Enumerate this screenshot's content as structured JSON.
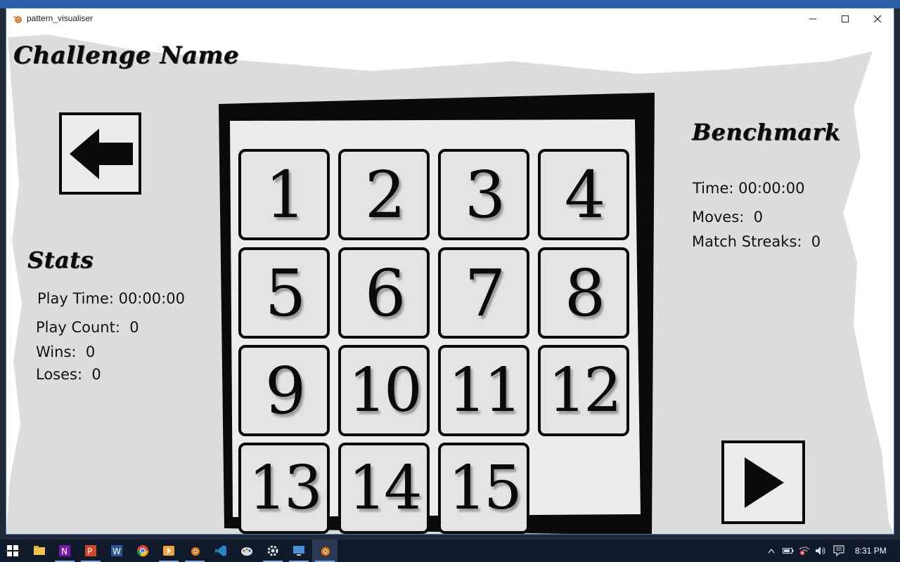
{
  "window": {
    "title": "pattern_visualiser",
    "minimize_glyph": "—",
    "maximize_glyph": "☐",
    "close_glyph": "✕"
  },
  "game": {
    "challenge_name": "Challenge Name",
    "stats": {
      "title": "Stats",
      "play_time": "Play Time: 00:00:00",
      "play_count": "Play Count:  0",
      "wins": "Wins:  0",
      "loses": "Loses:  0"
    },
    "benchmark": {
      "title": "Benchmark",
      "time": "Time: 00:00:00",
      "moves": "Moves:  0",
      "match_streaks": "Match Streaks:  0"
    },
    "tiles": [
      "1",
      "2",
      "3",
      "4",
      "5",
      "6",
      "7",
      "8",
      "9",
      "10",
      "11",
      "12",
      "13",
      "14",
      "15"
    ],
    "empty_slot": 16,
    "back_button_icon": "left-arrow-icon",
    "play_button_icon": "play-icon"
  },
  "taskbar": {
    "apps": [
      "start-icon",
      "file-explorer-icon",
      "onenote-icon",
      "powerpoint-icon",
      "word-icon",
      "chrome-icon",
      "media-player-icon",
      "blender-icon",
      "vscode-icon",
      "paint-icon",
      "settings-icon",
      "remote-desktop-icon",
      "blender-icon-active"
    ],
    "time": "8:31 PM"
  },
  "colors": {
    "window_border": "#3a74c7",
    "taskbar": "#0f1a2b",
    "tile_fill": "#e4e4e4",
    "ink": "#0a0a0a"
  }
}
